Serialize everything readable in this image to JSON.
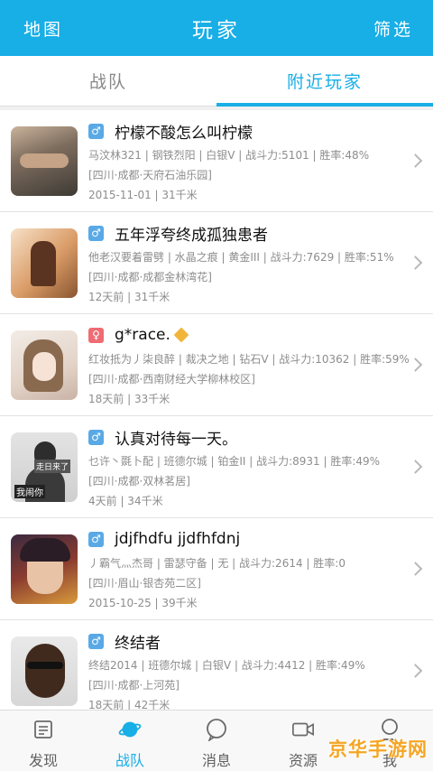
{
  "header": {
    "left": "地图",
    "title": "玩家",
    "right": "筛选"
  },
  "tabs": [
    {
      "label": "战队"
    },
    {
      "label": "附近玩家"
    }
  ],
  "players": [
    {
      "gender": "♂",
      "name": "柠檬不酸怎么叫柠檬",
      "stats": "马汶林321 | 钢铁烈阳 | 白银V | 战斗力:5101 | 胜率:48%",
      "location": "[四川·成都·天府石油乐园]",
      "meta": "2015-11-01 | 31千米"
    },
    {
      "gender": "♂",
      "name": "五年浮夸终成孤独患者",
      "stats": "他老汉要着雷劈 | 水晶之痕 | 黄金III | 战斗力:7629 | 胜率:51%",
      "location": "[四川·成都·成都金林湾花]",
      "meta": "12天前 | 31千米"
    },
    {
      "gender": "♀",
      "name": "g*race.",
      "stats": "红妆抵为丿柒良醉 | 裁决之地 | 钻石V | 战斗力:10362 | 胜率:59%",
      "location": "[四川·成都·西南财经大学柳林校区]",
      "meta": "18天前 | 33千米"
    },
    {
      "gender": "♂",
      "name": "认真对待每一天。",
      "stats": "乜许丶毲卜配 | 班德尔城 | 铂金II | 战斗力:8931 | 胜率:49%",
      "location": "[四川·成都·双林茗居]",
      "meta": "4天前 | 34千米"
    },
    {
      "gender": "♂",
      "name": "jdjfhdfu jjdfhfdnj",
      "stats": "丿霸气灬杰哥 | 雷瑟守备 | 无 | 战斗力:2614 | 胜率:0",
      "location": "[四川·眉山·银杏苑二区]",
      "meta": "2015-10-25 | 39千米"
    },
    {
      "gender": "♂",
      "name": "终结者",
      "stats": "终结2014 | 班德尔城 | 白银V | 战斗力:4412 | 胜率:49%",
      "location": "[四川·成都·上河苑]",
      "meta": "18天前 | 42千米"
    }
  ],
  "avatar_captions": {
    "top": "走日来了",
    "bottom": "我闹你"
  },
  "bottom_nav": [
    {
      "label": "发现"
    },
    {
      "label": "战队"
    },
    {
      "label": "消息"
    },
    {
      "label": "资源"
    },
    {
      "label": "我"
    }
  ],
  "watermark": "京华手游网",
  "colors": {
    "accent": "#18aee6",
    "male": "#59a9e6",
    "female": "#ee6c72",
    "watermark": "#f5a524"
  }
}
